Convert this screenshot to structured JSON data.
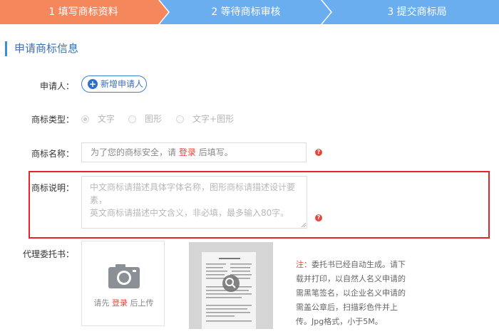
{
  "steps": [
    {
      "label": "1 填写商标资料",
      "color": "#f5875d"
    },
    {
      "label": "2 等待商标审核",
      "color": "#6aaef0"
    },
    {
      "label": "3 提交商标局",
      "color": "#6aaef0"
    }
  ],
  "section": {
    "title": "申请商标信息"
  },
  "applicant": {
    "label": "申请人：",
    "add_button": "新增申请人"
  },
  "trademark_type": {
    "label": "商标类型：",
    "options": [
      "文字",
      "图形",
      "文字+图形"
    ]
  },
  "trademark_name": {
    "label": "商标名称：",
    "placeholder_before": "为了您的商标安全，请",
    "login_link": "登录",
    "placeholder_after": "后填写。"
  },
  "trademark_desc": {
    "label": "商标说明：",
    "placeholder_line1": "中文商标请描述具体字体名称，图形商标请描述设计要素，",
    "placeholder_line2": "英文商标请描述中文含义，非必填，最多输入80字。"
  },
  "power_of_attorney": {
    "label": "代理委托书：",
    "upload_before": "请先",
    "upload_link": "登录",
    "upload_after": "后上传",
    "note_label": "注：",
    "note_text": "委托书已经自动生成。请下载并打印，以自然人名义申请的需黑笔签名，以企业名义申请的需盖公章后，扫描彩色件并上传。Jpg格式，小于5M。"
  },
  "colors": {
    "accent": "#3b8de0",
    "warning": "#e2483d",
    "highlight": "#e3252b"
  }
}
